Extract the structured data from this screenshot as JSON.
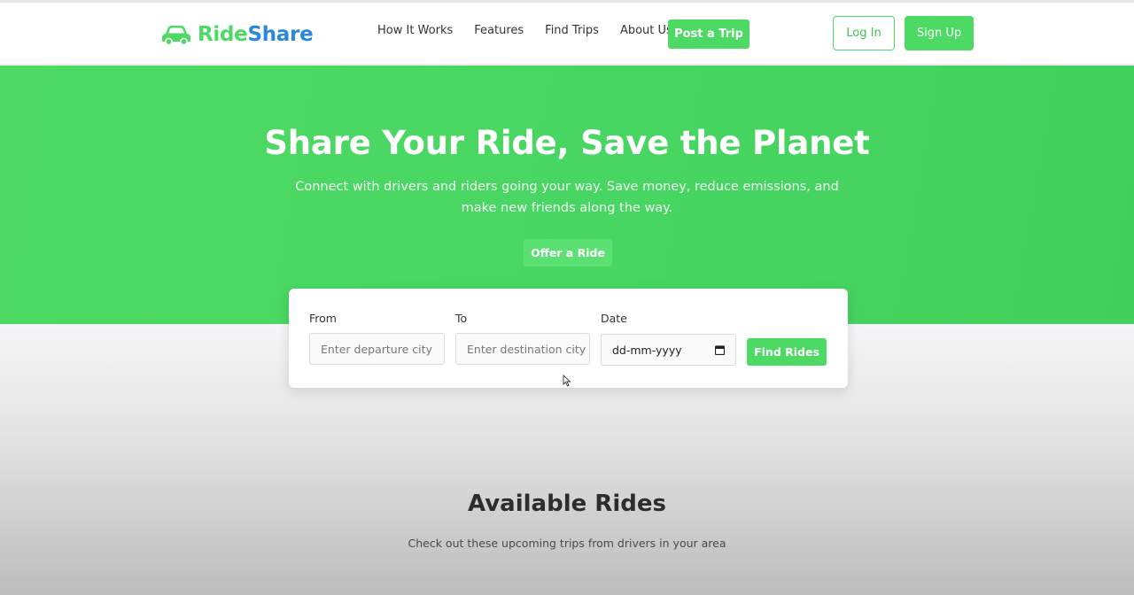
{
  "brand": {
    "name_part1": "Ride",
    "name_part2": "Share",
    "logo_icon": "car-icon",
    "colors": {
      "green": "#4cd964",
      "blue": "#2b87d8"
    }
  },
  "nav": {
    "links": [
      "How It Works",
      "Features",
      "Find Trips",
      "About Us"
    ],
    "post_trip_label": "Post a Trip",
    "login_label": "Log In",
    "signup_label": "Sign Up"
  },
  "hero": {
    "title": "Share Your Ride, Save the Planet",
    "subtitle": "Connect with drivers and riders going your way. Save money, reduce emissions, and make new friends along the way.",
    "offer_label": "Offer a Ride"
  },
  "search": {
    "from_label": "From",
    "from_placeholder": "Enter departure city",
    "to_label": "To",
    "to_placeholder": "Enter destination city",
    "date_label": "Date",
    "date_value": "dd-mm-yyyy",
    "find_label": "Find Rides"
  },
  "rides_section": {
    "title": "Available Rides",
    "subtitle": "Check out these upcoming trips from drivers in your area"
  }
}
